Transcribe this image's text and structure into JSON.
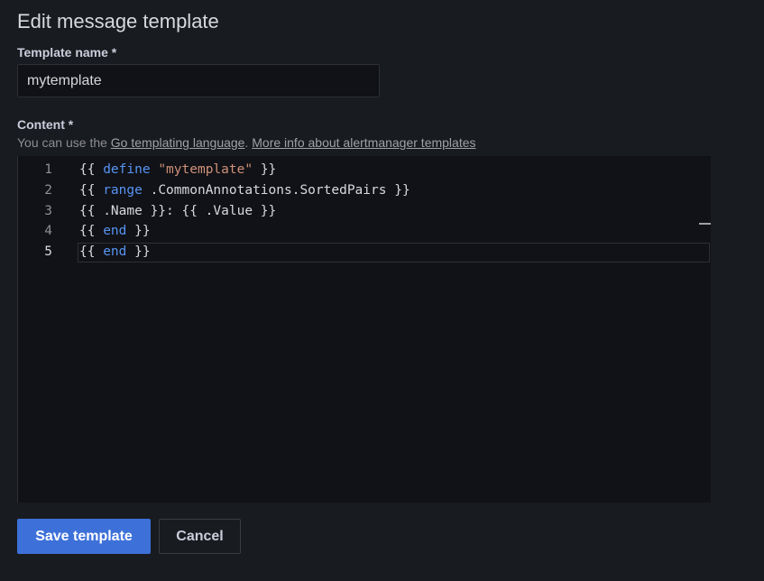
{
  "page": {
    "title": "Edit message template"
  },
  "form": {
    "name_label": "Template name *",
    "name_value": "mytemplate",
    "content_label": "Content *",
    "description_prefix": "You can use the ",
    "go_link": "Go templating language",
    "description_mid": ". ",
    "alertmanager_link": "More info about alertmanager templates"
  },
  "editor": {
    "line_numbers": [
      "1",
      "2",
      "3",
      "4",
      "5"
    ],
    "lines": [
      [
        {
          "t": "{{ ",
          "c": ""
        },
        {
          "t": "define",
          "c": "kw"
        },
        {
          "t": " ",
          "c": ""
        },
        {
          "t": "\"mytemplate\"",
          "c": "str"
        },
        {
          "t": " }}",
          "c": ""
        }
      ],
      [
        {
          "t": "{{ ",
          "c": ""
        },
        {
          "t": "range",
          "c": "kw"
        },
        {
          "t": " .CommonAnnotations.SortedPairs }}",
          "c": ""
        }
      ],
      [
        {
          "t": "{{ .Name }}: {{ .Value }}",
          "c": ""
        }
      ],
      [
        {
          "t": "{{ ",
          "c": ""
        },
        {
          "t": "end",
          "c": "kw"
        },
        {
          "t": " }}",
          "c": ""
        }
      ],
      [
        {
          "t": "{{ ",
          "c": ""
        },
        {
          "t": "end",
          "c": "kw"
        },
        {
          "t": " }}",
          "c": ""
        }
      ]
    ],
    "active_line": 5
  },
  "actions": {
    "save_label": "Save template",
    "cancel_label": "Cancel"
  },
  "colors": {
    "background": "#181b1f",
    "editor_background": "#111217",
    "primary": "#3d71d9",
    "keyword": "#5794f2",
    "string": "#ce9178"
  }
}
